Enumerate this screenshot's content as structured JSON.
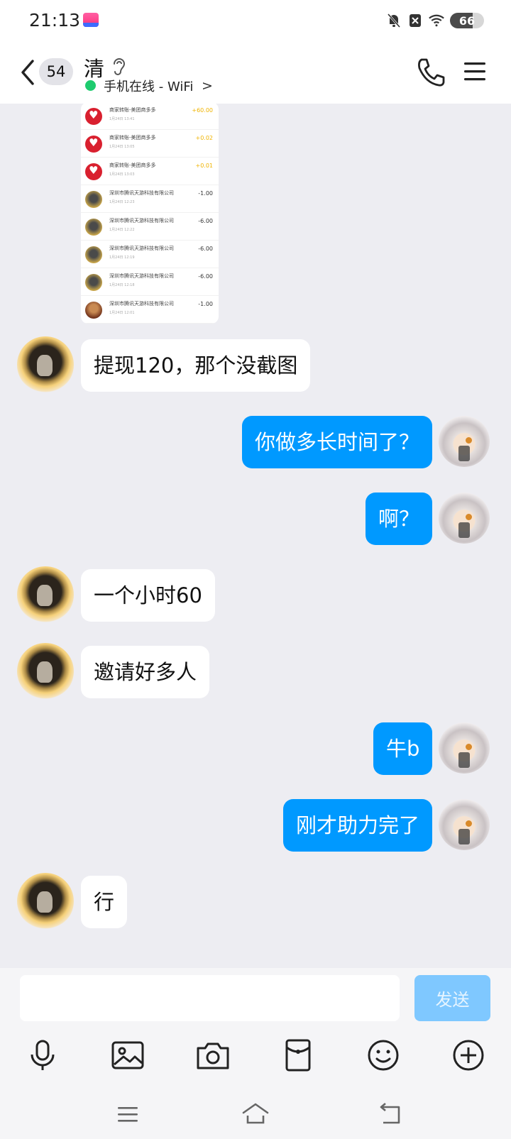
{
  "status_bar": {
    "time": "21:13",
    "battery": "66",
    "battery_level_percent": 66
  },
  "header": {
    "unread_count": "54",
    "contact_name": "清",
    "online_status": "手机在线 - WiFi",
    "online_chevron": ">"
  },
  "chat": {
    "screenshot_rows": [
      {
        "name": "商家转账-美团商多多",
        "date": "1月24日 13:41",
        "amount": "+60.00",
        "logo": "pdd"
      },
      {
        "name": "商家转账-美团商多多",
        "date": "1月24日 13:05",
        "amount": "+0.02",
        "logo": "pdd"
      },
      {
        "name": "商家转账-美团商多多",
        "date": "1月24日 13:03",
        "amount": "+0.01",
        "logo": "pdd"
      },
      {
        "name": "深圳市腾讯天游科技有限公司",
        "date": "1月24日 12:23",
        "amount": "-1.00",
        "logo": "gold"
      },
      {
        "name": "深圳市腾讯天游科技有限公司",
        "date": "1月24日 12:22",
        "amount": "-6.00",
        "logo": "gold"
      },
      {
        "name": "深圳市腾讯天游科技有限公司",
        "date": "1月24日 12:19",
        "amount": "-6.00",
        "logo": "gold"
      },
      {
        "name": "深圳市腾讯天游科技有限公司",
        "date": "1月24日 12:18",
        "amount": "-6.00",
        "logo": "gold"
      },
      {
        "name": "深圳市腾讯天游科技有限公司",
        "date": "1月24日 12:01",
        "amount": "-1.00",
        "logo": "hero"
      }
    ],
    "messages": [
      {
        "side": "left",
        "text": "提现120，那个没截图"
      },
      {
        "side": "right",
        "text": "你做多长时间了？"
      },
      {
        "side": "right",
        "text": "啊？"
      },
      {
        "side": "left",
        "text": "一个小时60"
      },
      {
        "side": "left",
        "text": "邀请好多人"
      },
      {
        "side": "right",
        "text": "牛b"
      },
      {
        "side": "right",
        "text": "刚才助力完了"
      },
      {
        "side": "left",
        "text": "行"
      }
    ]
  },
  "input": {
    "value": "",
    "placeholder": "",
    "send_label": "发送"
  },
  "toolbar": {
    "icons": [
      "microphone-icon",
      "image-icon",
      "camera-icon",
      "red-packet-icon",
      "emoji-icon",
      "plus-icon"
    ]
  },
  "colors": {
    "accent": "#0099ff",
    "send_disabled": "#7fc8ff",
    "online": "#1ecb6e",
    "background": "#ededf2"
  }
}
